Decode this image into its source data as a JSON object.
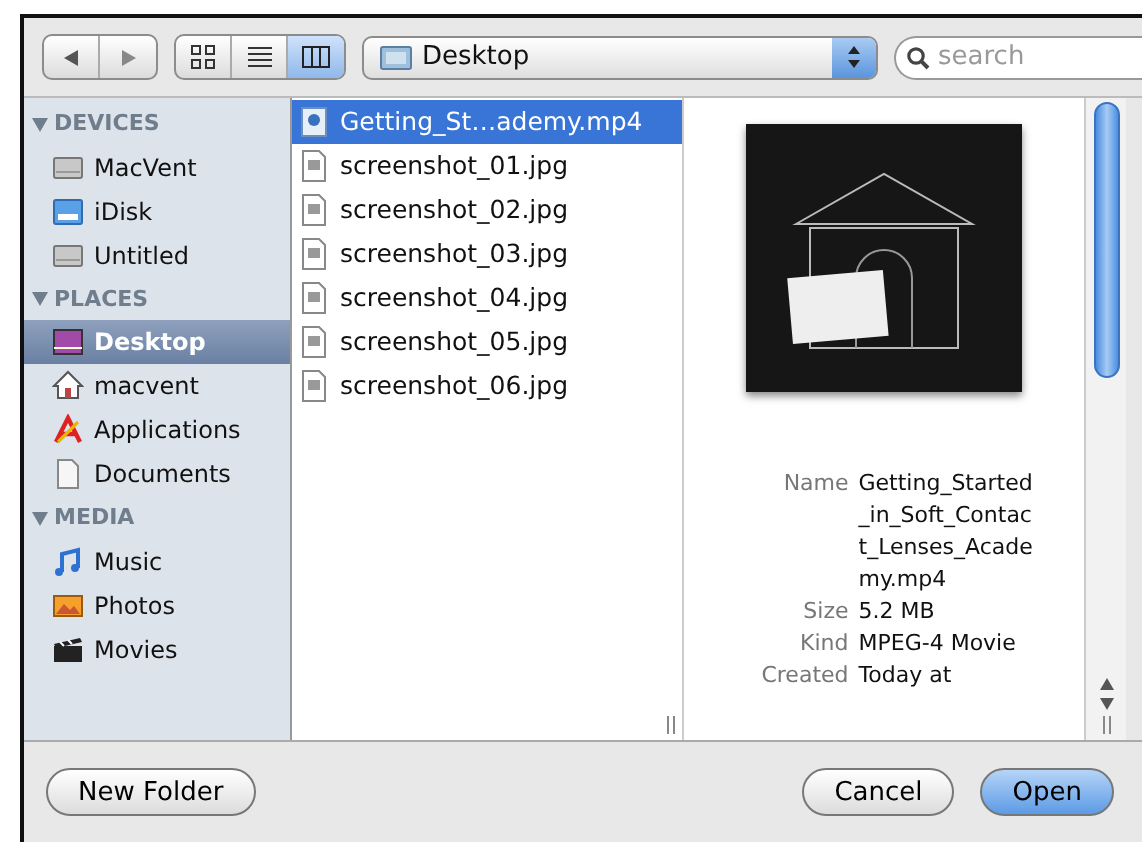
{
  "toolbar": {
    "view_buttons": [
      {
        "kind": "icons",
        "selected": false
      },
      {
        "kind": "list",
        "selected": false
      },
      {
        "kind": "columns",
        "selected": true
      }
    ],
    "location": "Desktop",
    "search": {
      "placeholder": "search"
    }
  },
  "sidebar": [
    {
      "title": "DEVICES",
      "expanded": true,
      "items": [
        {
          "label": "MacVent",
          "kind": "disk",
          "selected": false
        },
        {
          "label": "iDisk",
          "kind": "idisk",
          "selected": false
        },
        {
          "label": "Untitled",
          "kind": "disk",
          "selected": false
        }
      ]
    },
    {
      "title": "PLACES",
      "expanded": true,
      "items": [
        {
          "label": "Desktop",
          "kind": "desktop",
          "selected": true
        },
        {
          "label": "macvent",
          "kind": "home",
          "selected": false
        },
        {
          "label": "Applications",
          "kind": "apps",
          "selected": false
        },
        {
          "label": "Documents",
          "kind": "docs",
          "selected": false
        }
      ]
    },
    {
      "title": "MEDIA",
      "expanded": true,
      "items": [
        {
          "label": "Music",
          "kind": "music",
          "selected": false
        },
        {
          "label": "Photos",
          "kind": "photos",
          "selected": false
        },
        {
          "label": "Movies",
          "kind": "movies",
          "selected": false
        }
      ]
    }
  ],
  "files": [
    {
      "name": "Getting_St…ademy.mp4",
      "kind": "movie",
      "selected": true
    },
    {
      "name": "screenshot_01.jpg",
      "kind": "image",
      "selected": false
    },
    {
      "name": "screenshot_02.jpg",
      "kind": "image",
      "selected": false
    },
    {
      "name": "screenshot_03.jpg",
      "kind": "image",
      "selected": false
    },
    {
      "name": "screenshot_04.jpg",
      "kind": "image",
      "selected": false
    },
    {
      "name": "screenshot_05.jpg",
      "kind": "image",
      "selected": false
    },
    {
      "name": "screenshot_06.jpg",
      "kind": "image",
      "selected": false
    }
  ],
  "preview": {
    "info": [
      {
        "label": "Name",
        "value": "Getting_Started_in_Soft_Contact_Lenses_Academy.mp4"
      },
      {
        "label": "Size",
        "value": "5.2 MB"
      },
      {
        "label": "Kind",
        "value": "MPEG-4 Movie"
      },
      {
        "label": "Created",
        "value": "Today at"
      }
    ]
  },
  "buttons": [
    {
      "label": "New Folder",
      "kind": "plain"
    },
    {
      "label": "Cancel",
      "kind": "plain"
    },
    {
      "label": "Open",
      "kind": "default"
    }
  ]
}
